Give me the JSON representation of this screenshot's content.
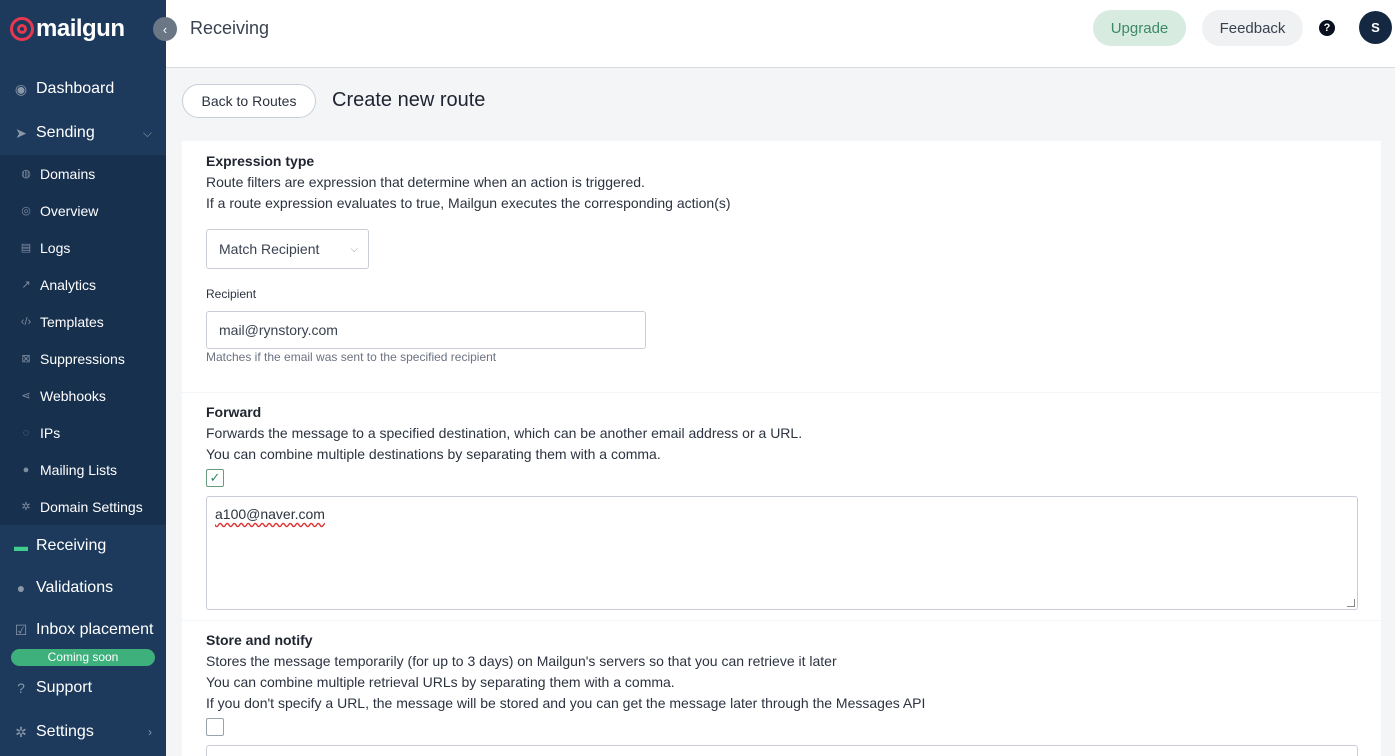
{
  "brand": {
    "name": "mailgun"
  },
  "sidebar": {
    "top_items": [
      {
        "label": "Dashboard",
        "icon": "dashboard-icon"
      },
      {
        "label": "Sending",
        "icon": "paper-plane-icon"
      }
    ],
    "sending_sub": [
      {
        "label": "Domains",
        "icon": "globe-icon"
      },
      {
        "label": "Overview",
        "icon": "eye-icon"
      },
      {
        "label": "Logs",
        "icon": "document-icon"
      },
      {
        "label": "Analytics",
        "icon": "chart-icon"
      },
      {
        "label": "Templates",
        "icon": "code-icon"
      },
      {
        "label": "Suppressions",
        "icon": "block-icon"
      },
      {
        "label": "Webhooks",
        "icon": "share-icon"
      },
      {
        "label": "IPs",
        "icon": "location-icon"
      },
      {
        "label": "Mailing Lists",
        "icon": "user-icon"
      },
      {
        "label": "Domain Settings",
        "icon": "gear-icon"
      }
    ],
    "bottom_items": [
      {
        "label": "Receiving",
        "icon": "inbox-icon"
      },
      {
        "label": "Validations",
        "icon": "user-check-icon"
      },
      {
        "label": "Inbox placement",
        "icon": "checkbox-icon"
      },
      {
        "label": "Support",
        "icon": "help-icon"
      },
      {
        "label": "Settings",
        "icon": "gear-icon"
      }
    ],
    "coming_soon": "Coming soon"
  },
  "header": {
    "title": "Receiving",
    "upgrade": "Upgrade",
    "feedback": "Feedback",
    "help": "?",
    "avatar": "S"
  },
  "page": {
    "back": "Back to Routes",
    "title": "Create new route"
  },
  "expression": {
    "title": "Expression type",
    "line1": "Route filters are expression that determine when an action is triggered.",
    "line2": "If a route expression evaluates to true, Mailgun executes the corresponding action(s)",
    "select_value": "Match Recipient",
    "recipient_label": "Recipient",
    "recipient_value": "mail@rynstory.com",
    "recipient_hint": "Matches if the email was sent to the specified recipient"
  },
  "forward": {
    "title": "Forward",
    "line1": "Forwards the message to a specified destination, which can be another email address or a URL.",
    "line2": "You can combine multiple destinations by separating them with a comma.",
    "checked": true,
    "value": "a100@naver.com"
  },
  "store": {
    "title": "Store and notify",
    "line1": "Stores the message temporarily (for up to 3 days) on Mailgun's servers so that you can retrieve it later",
    "line2": "You can combine multiple retrieval URLs by separating them with a comma.",
    "line3": "If you don't specify a URL, the message will be stored and you can get the message later through the Messages API",
    "checked": false
  }
}
